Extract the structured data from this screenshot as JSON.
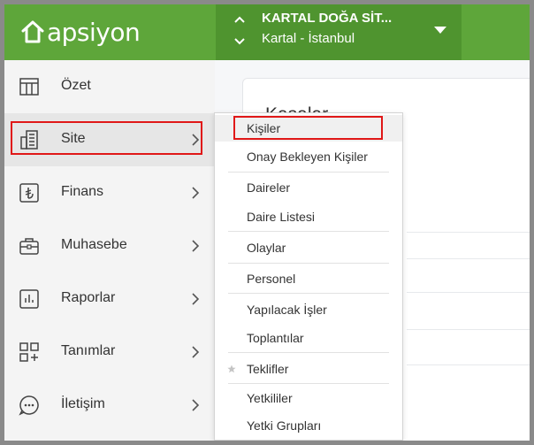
{
  "app": {
    "logo_text": "apsiyon"
  },
  "header": {
    "site_name": "KARTAL DOĞA SİT...",
    "site_location": "Kartal - İstanbul"
  },
  "sidebar": {
    "items": [
      {
        "label": "Özet",
        "icon": "table-icon"
      },
      {
        "label": "Site",
        "icon": "building-icon"
      },
      {
        "label": "Finans",
        "icon": "lira-icon"
      },
      {
        "label": "Muhasebe",
        "icon": "briefcase-icon"
      },
      {
        "label": "Raporlar",
        "icon": "bar-chart-icon"
      },
      {
        "label": "Tanımlar",
        "icon": "grid-plus-icon"
      },
      {
        "label": "İletişim",
        "icon": "chat-bubble-icon"
      }
    ]
  },
  "main": {
    "title": "Kasalar"
  },
  "dropdown": {
    "items": [
      {
        "label": "Kişiler"
      },
      {
        "label": "Onay Bekleyen Kişiler"
      },
      {
        "label": "Daireler"
      },
      {
        "label": "Daire Listesi"
      },
      {
        "label": "Olaylar"
      },
      {
        "label": "Personel"
      },
      {
        "label": "Yapılacak İşler"
      },
      {
        "label": "Toplantılar"
      },
      {
        "label": "Teklifler"
      },
      {
        "label": "Yetkililer"
      },
      {
        "label": "Yetki Grupları"
      }
    ]
  },
  "colors": {
    "header_green": "#5ea63a",
    "switcher_green": "#4f942f",
    "highlight_red": "#e01818"
  }
}
